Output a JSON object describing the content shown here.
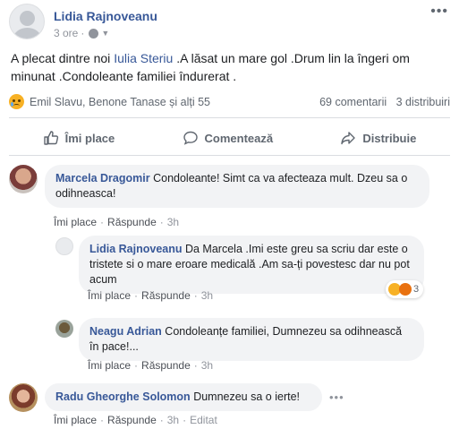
{
  "post": {
    "author": "Lidia Rajnoveanu",
    "time": "3 ore",
    "meta_separator": "·",
    "text_part1": "A plecat dintre noi ",
    "mention": "Iulia Steriu",
    "text_part2": " .A lăsat un mare gol .Drum lin la îngeri om minunat .Condoleante familiei îndurerat ."
  },
  "reactions": {
    "reactors": "Emil Slavu, Benone Tanase și alți 55",
    "comments_count": "69 comentarii",
    "shares_count": "3 distribuiri"
  },
  "actions": {
    "like": "Îmi place",
    "comment": "Comentează",
    "share": "Distribuie"
  },
  "comments": [
    {
      "author": "Marcela Dragomir",
      "text": "Condoleante! Simt ca va afecteaza mult. Dzeu sa o odihneasca!",
      "like": "Îmi place",
      "reply": "Răspunde",
      "time": "3h"
    },
    {
      "author": "Lidia Rajnoveanu",
      "text": "Da Marcela .Imi este greu sa scriu dar este o tristete si o mare eroare medicală .Am sa-ți povestesc dar nu pot acum",
      "like": "Îmi place",
      "reply": "Răspunde",
      "time": "3h",
      "reaction_count": "3"
    },
    {
      "author": "Neagu Adrian",
      "text": "Condoleanțe familiei, Dumnezeu sa odihnească în pace!...",
      "like": "Îmi place",
      "reply": "Răspunde",
      "time": "3h"
    },
    {
      "author": "Radu Gheorghe Solomon",
      "text": "Dumnezeu sa o ierte!",
      "like": "Îmi place",
      "reply": "Răspunde",
      "time": "3h",
      "edited": "Editat"
    }
  ],
  "meta_separator": "·",
  "icons": {
    "more": "more-icon",
    "globe": "globe-icon",
    "like": "thumbs-up-icon",
    "comment": "comment-bubble-icon",
    "share": "share-arrow-icon"
  }
}
